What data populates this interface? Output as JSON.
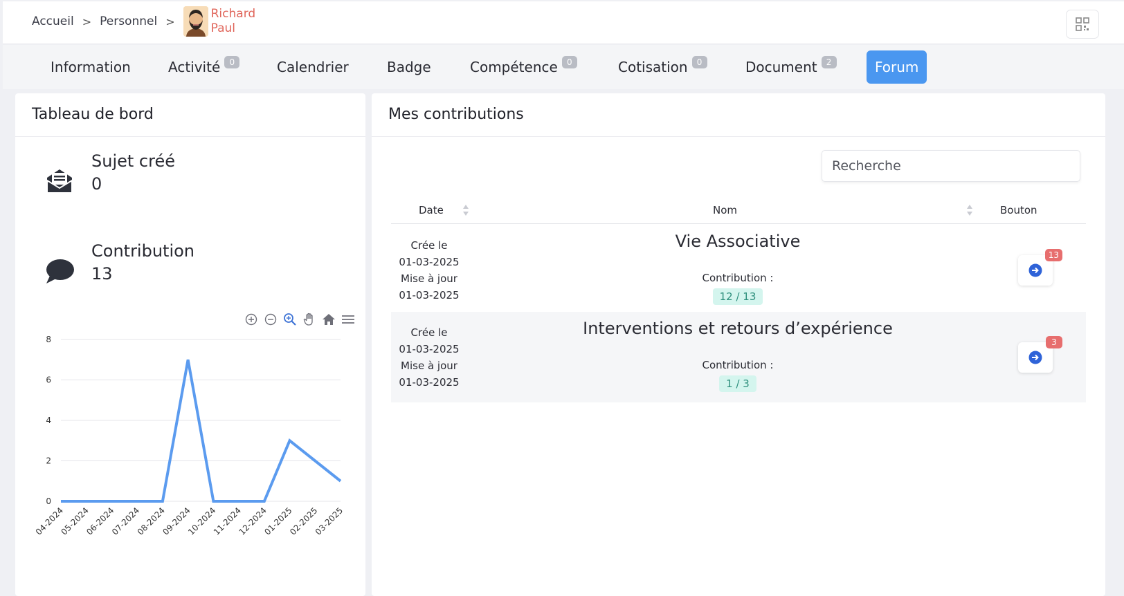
{
  "breadcrumb": {
    "home": "Accueil",
    "section": "Personnel",
    "user_first": "Richard",
    "user_last": "Paul"
  },
  "tabs": [
    {
      "label": "Information",
      "badge": null
    },
    {
      "label": "Activité",
      "badge": "0"
    },
    {
      "label": "Calendrier",
      "badge": null
    },
    {
      "label": "Badge",
      "badge": null
    },
    {
      "label": "Compétence",
      "badge": "0"
    },
    {
      "label": "Cotisation",
      "badge": "0"
    },
    {
      "label": "Document",
      "badge": "2"
    },
    {
      "label": "Forum",
      "badge": null,
      "active": true
    }
  ],
  "dashboard": {
    "title": "Tableau de bord",
    "topics_label": "Sujet créé",
    "topics_value": "0",
    "contrib_label": "Contribution",
    "contrib_value": "13"
  },
  "chart_data": {
    "type": "line",
    "categories": [
      "04-2024",
      "05-2024",
      "06-2024",
      "07-2024",
      "08-2024",
      "09-2024",
      "10-2024",
      "11-2024",
      "12-2024",
      "01-2025",
      "02-2025",
      "03-2025"
    ],
    "values": [
      0,
      0,
      0,
      0,
      0,
      7,
      0,
      0,
      0,
      3,
      2,
      1
    ],
    "ylim": [
      0,
      8
    ],
    "yticks": [
      0,
      2,
      4,
      6,
      8
    ],
    "grid": true,
    "color": "#5b9bef"
  },
  "contributions": {
    "title": "Mes contributions",
    "search_placeholder": "Recherche",
    "columns": {
      "date": "Date",
      "name": "Nom",
      "button": "Bouton"
    },
    "rows": [
      {
        "created_label": "Crée le",
        "created": "01-03-2025",
        "updated_label": "Mise à jour",
        "updated": "01-03-2025",
        "name": "Vie Associative",
        "contrib_label": "Contribution :",
        "contrib": "12 / 13",
        "badge": "13"
      },
      {
        "created_label": "Crée le",
        "created": "01-03-2025",
        "updated_label": "Mise à jour",
        "updated": "01-03-2025",
        "name": "Interventions et retours d’expérience",
        "contrib_label": "Contribution :",
        "contrib": "1 / 3",
        "badge": "3"
      }
    ]
  },
  "colors": {
    "accent": "#4a97f0",
    "user_name": "#e0655a",
    "badge_red": "#e76e6e",
    "pill_bg": "#d4f5ee",
    "pill_text": "#2d8f7c"
  }
}
